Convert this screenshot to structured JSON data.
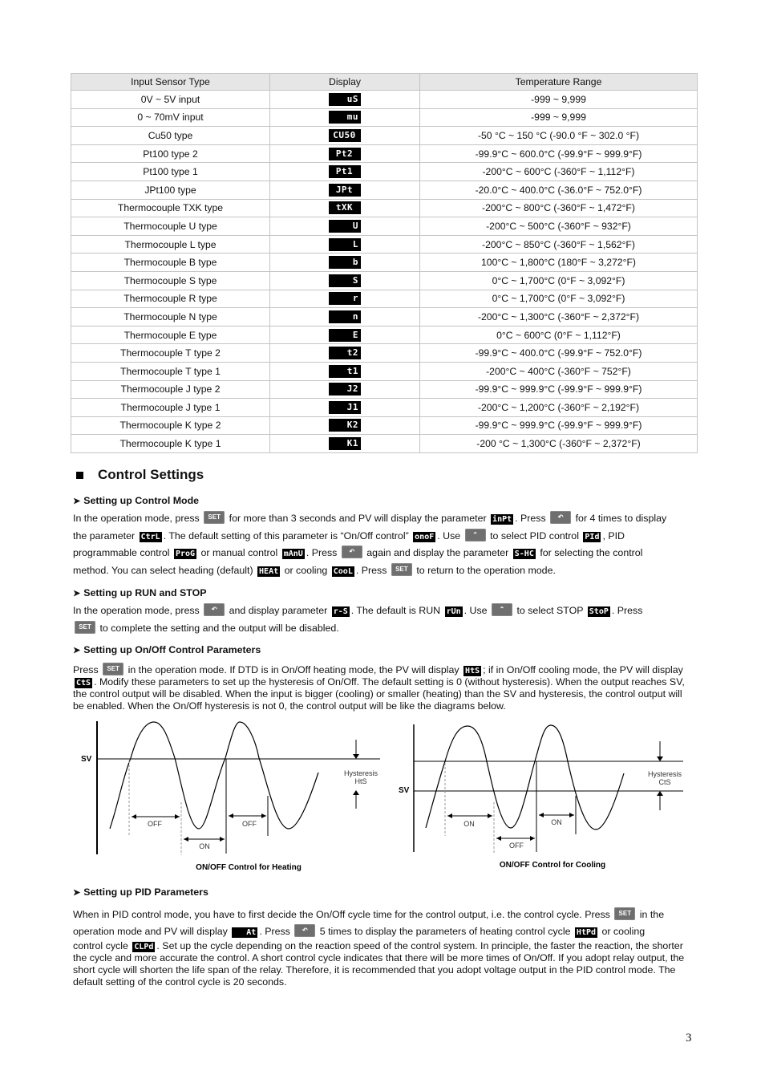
{
  "table": {
    "headers": [
      "Input Sensor Type",
      "Display",
      "Temperature Range"
    ],
    "rows": [
      {
        "type": "0V ~ 5V input",
        "display": "uS",
        "range": "-999 ~ 9,999"
      },
      {
        "type": "0 ~ 70mV input",
        "display": "mu",
        "range": "-999 ~ 9,999"
      },
      {
        "type": "Cu50 type",
        "display": "CU50",
        "range": "-50 °C ~ 150 °C (-90.0 °F ~ 302.0 °F)"
      },
      {
        "type": "Pt100 type 2",
        "display": "Pt2",
        "range": "-99.9°C ~ 600.0°C (-99.9°F ~ 999.9°F)"
      },
      {
        "type": "Pt100 type 1",
        "display": "Pt1",
        "range": "-200°C ~ 600°C (-360°F ~ 1,112°F)"
      },
      {
        "type": "JPt100 type",
        "display": "JPt",
        "range": "-20.0°C ~ 400.0°C (-36.0°F ~ 752.0°F)"
      },
      {
        "type": "Thermocouple TXK type",
        "display": "tXK",
        "range": "-200°C ~ 800°C (-360°F ~ 1,472°F)"
      },
      {
        "type": "Thermocouple U type",
        "display": "U",
        "range": "-200°C ~ 500°C (-360°F ~ 932°F)"
      },
      {
        "type": "Thermocouple L type",
        "display": "L",
        "range": "-200°C ~ 850°C (-360°F ~ 1,562°F)"
      },
      {
        "type": "Thermocouple B type",
        "display": "b",
        "range": "100°C ~ 1,800°C (180°F ~ 3,272°F)"
      },
      {
        "type": "Thermocouple S type",
        "display": "S",
        "range": "0°C ~ 1,700°C (0°F ~ 3,092°F)"
      },
      {
        "type": "Thermocouple R type",
        "display": "r",
        "range": "0°C ~ 1,700°C (0°F ~ 3,092°F)"
      },
      {
        "type": "Thermocouple N type",
        "display": "n",
        "range": "-200°C ~ 1,300°C (-360°F ~ 2,372°F)"
      },
      {
        "type": "Thermocouple E type",
        "display": "E",
        "range": "0°C ~ 600°C (0°F ~ 1,112°F)"
      },
      {
        "type": "Thermocouple T type 2",
        "display": "t2",
        "range": "-99.9°C ~ 400.0°C (-99.9°F ~ 752.0°F)"
      },
      {
        "type": "Thermocouple T type 1",
        "display": "t1",
        "range": "-200°C ~ 400°C (-360°F ~ 752°F)"
      },
      {
        "type": "Thermocouple J type 2",
        "display": "J2",
        "range": "-99.9°C ~ 999.9°C (-99.9°F ~ 999.9°F)"
      },
      {
        "type": "Thermocouple J type 1",
        "display": "J1",
        "range": "-200°C ~ 1,200°C (-360°F ~ 2,192°F)"
      },
      {
        "type": "Thermocouple K type 2",
        "display": "K2",
        "range": "-99.9°C ~ 999.9°C (-99.9°F ~ 999.9°F)"
      },
      {
        "type": "Thermocouple K type 1",
        "display": "K1",
        "range": "-200 °C ~ 1,300°C (-360°F ~ 2,372°F)"
      }
    ]
  },
  "section": {
    "title": "Control Settings"
  },
  "buttons": {
    "set": "SET"
  },
  "control_mode": {
    "heading": "Setting up Control Mode",
    "t1": "In the operation mode, press",
    "t2": "for more than 3 seconds and PV will display the parameter",
    "p_inpt": "inPt",
    "t3": ". Press",
    "t4": "for 4 times to display",
    "t5": "the parameter",
    "p_ctrl": "CtrL",
    "t6": ". The default setting of this parameter is “On/Off control”",
    "p_onof": "onoF",
    "t7": ". Use",
    "t8": "to select PID control",
    "p_pid": "PId",
    "t9": ", PID",
    "t10": "programmable control",
    "p_prog": "ProG",
    "t11": "or manual control",
    "p_manu": "mAnU",
    "t12": ". Press",
    "t13": "again and display the parameter",
    "p_shc": "S-HC",
    "t14": "for selecting the control",
    "t15": "method. You can select heading (default)",
    "p_heat": "HEAt",
    "t16": "or cooling",
    "p_cool": "CooL",
    "t17": ". Press",
    "t18": "to return to the operation mode."
  },
  "run_stop": {
    "heading": "Setting up RUN and STOP",
    "t1": "In the operation mode, press",
    "t2": "and display parameter",
    "p_rs": "r-S",
    "t3": ". The default is RUN",
    "p_run": "rUn",
    "t4": ". Use",
    "t5": "to select STOP",
    "p_stop": "StoP",
    "t6": ". Press",
    "t7": "to complete the setting and the output will be disabled."
  },
  "onoff": {
    "heading": "Setting up On/Off Control Parameters",
    "t1": "Press",
    "t2": "in the operation mode. If DTD is in On/Off heating mode, the PV will display",
    "p_hts": "HtS",
    "t3": "; if in On/Off cooling mode, the PV will display",
    "p_cts": "CtS",
    "t4": ". Modify these parameters to set up the hysteresis of On/Off. The default setting is 0 (without hysteresis). When the output reaches SV, the control output will be disabled. When the input is bigger (cooling) or smaller (heating) than the SV and hysteresis, the control output will be enabled. When the On/Off hysteresis is not 0, the control output will be like the diagrams below."
  },
  "diagrams": {
    "heating": {
      "sv": "SV",
      "hyst1": "Hysteresis",
      "hyst2": "HtS",
      "off1": "OFF",
      "off2": "OFF",
      "on": "ON",
      "caption": "ON/OFF Control for Heating"
    },
    "cooling": {
      "sv": "SV",
      "hyst1": "Hysteresis",
      "hyst2": "CtS",
      "on1": "ON",
      "on2": "ON",
      "off": "OFF",
      "caption": "ON/OFF Control for Cooling"
    }
  },
  "pid": {
    "heading": "Setting up PID Parameters",
    "t1": "When in PID control mode, you have to first decide the On/Off cycle time for the control output, i.e. the control cycle. Press",
    "t2": "in the",
    "t3": "operation mode and PV will display",
    "p_at": "At",
    "t4": ". Press",
    "t5": "5 times to display the parameters of heating control cycle",
    "p_htpd": "HtPd",
    "t6": "or cooling",
    "t7": "control cycle",
    "p_clpd": "CLPd",
    "t8": ". Set up the cycle depending on the reaction speed of the control system. In principle, the faster the reaction, the shorter the cycle and more accurate the control. A short control cycle indicates that there will be more times of On/Off. If you adopt relay output, the short cycle will shorten the life span of the relay. Therefore, it is recommended that you adopt voltage output in the PID control mode. The default setting of the control cycle is 20 seconds."
  },
  "page_number": "3"
}
